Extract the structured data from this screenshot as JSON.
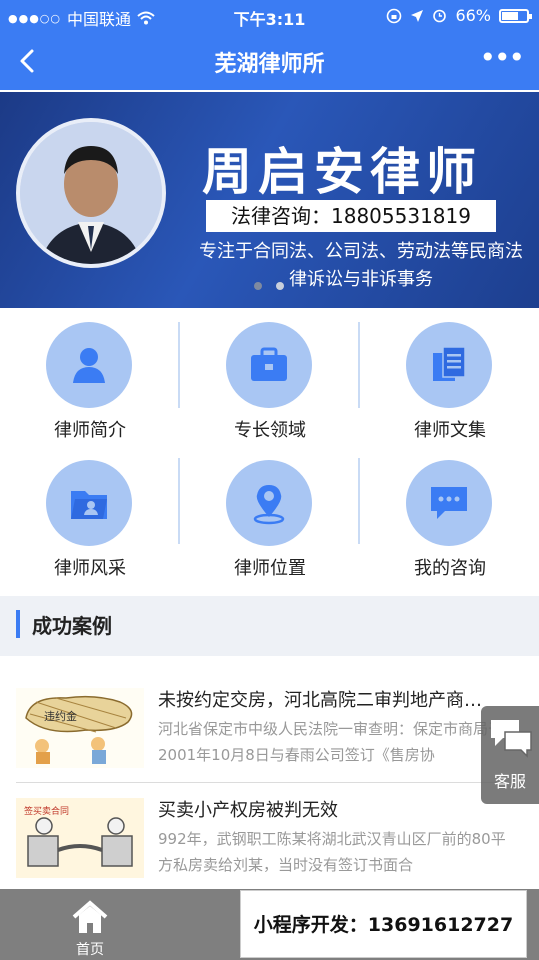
{
  "status_bar": {
    "signal": "●●●○○",
    "carrier": "中国联通",
    "time": "下午3:11",
    "battery_text": "66%",
    "battery_level": 0.66
  },
  "nav": {
    "title": "芜湖律师所",
    "more": "•••"
  },
  "banner": {
    "name": "周启安律师",
    "phone": "法律咨询：18805531819",
    "description": "专注于合同法、公司法、劳动法等民商法律诉讼与非诉事务",
    "slide_index": 1,
    "slide_count": 2
  },
  "menu": {
    "items": [
      {
        "label": "律师简介",
        "icon": "person-icon"
      },
      {
        "label": "专长领域",
        "icon": "briefcase-icon"
      },
      {
        "label": "律师文集",
        "icon": "documents-icon"
      },
      {
        "label": "律师风采",
        "icon": "folder-icon"
      },
      {
        "label": "律师位置",
        "icon": "location-pin-icon"
      },
      {
        "label": "我的咨询",
        "icon": "chat-icon"
      }
    ]
  },
  "section": {
    "title": "成功案例"
  },
  "cases": [
    {
      "title": "未按约定交房，河北高院二审判地产商…",
      "snippet": "河北省保定市中级人民法院一审查明：保定市商局于2001年10月8日与春雨公司签订《售房协",
      "thumb_text": "违约金"
    },
    {
      "title": "买卖小产权房被判无效",
      "snippet": "992年，武钢职工陈某将湖北武汉青山区厂前的80平方私房卖给刘某，当时没有签订书面合",
      "thumb_text": "签买卖合同"
    }
  ],
  "floating": {
    "service_label": "客服"
  },
  "tab_bar": {
    "items": [
      {
        "label": "首页",
        "icon": "home-icon"
      },
      {
        "label": "",
        "icon": ""
      },
      {
        "label": "",
        "icon": ""
      }
    ]
  },
  "promo": {
    "text": "小程序开发：13691612727"
  },
  "colors": {
    "primary": "#3b7cf3",
    "icon_circle": "#a9c6f3",
    "banner_dark": "#1c3a86"
  }
}
